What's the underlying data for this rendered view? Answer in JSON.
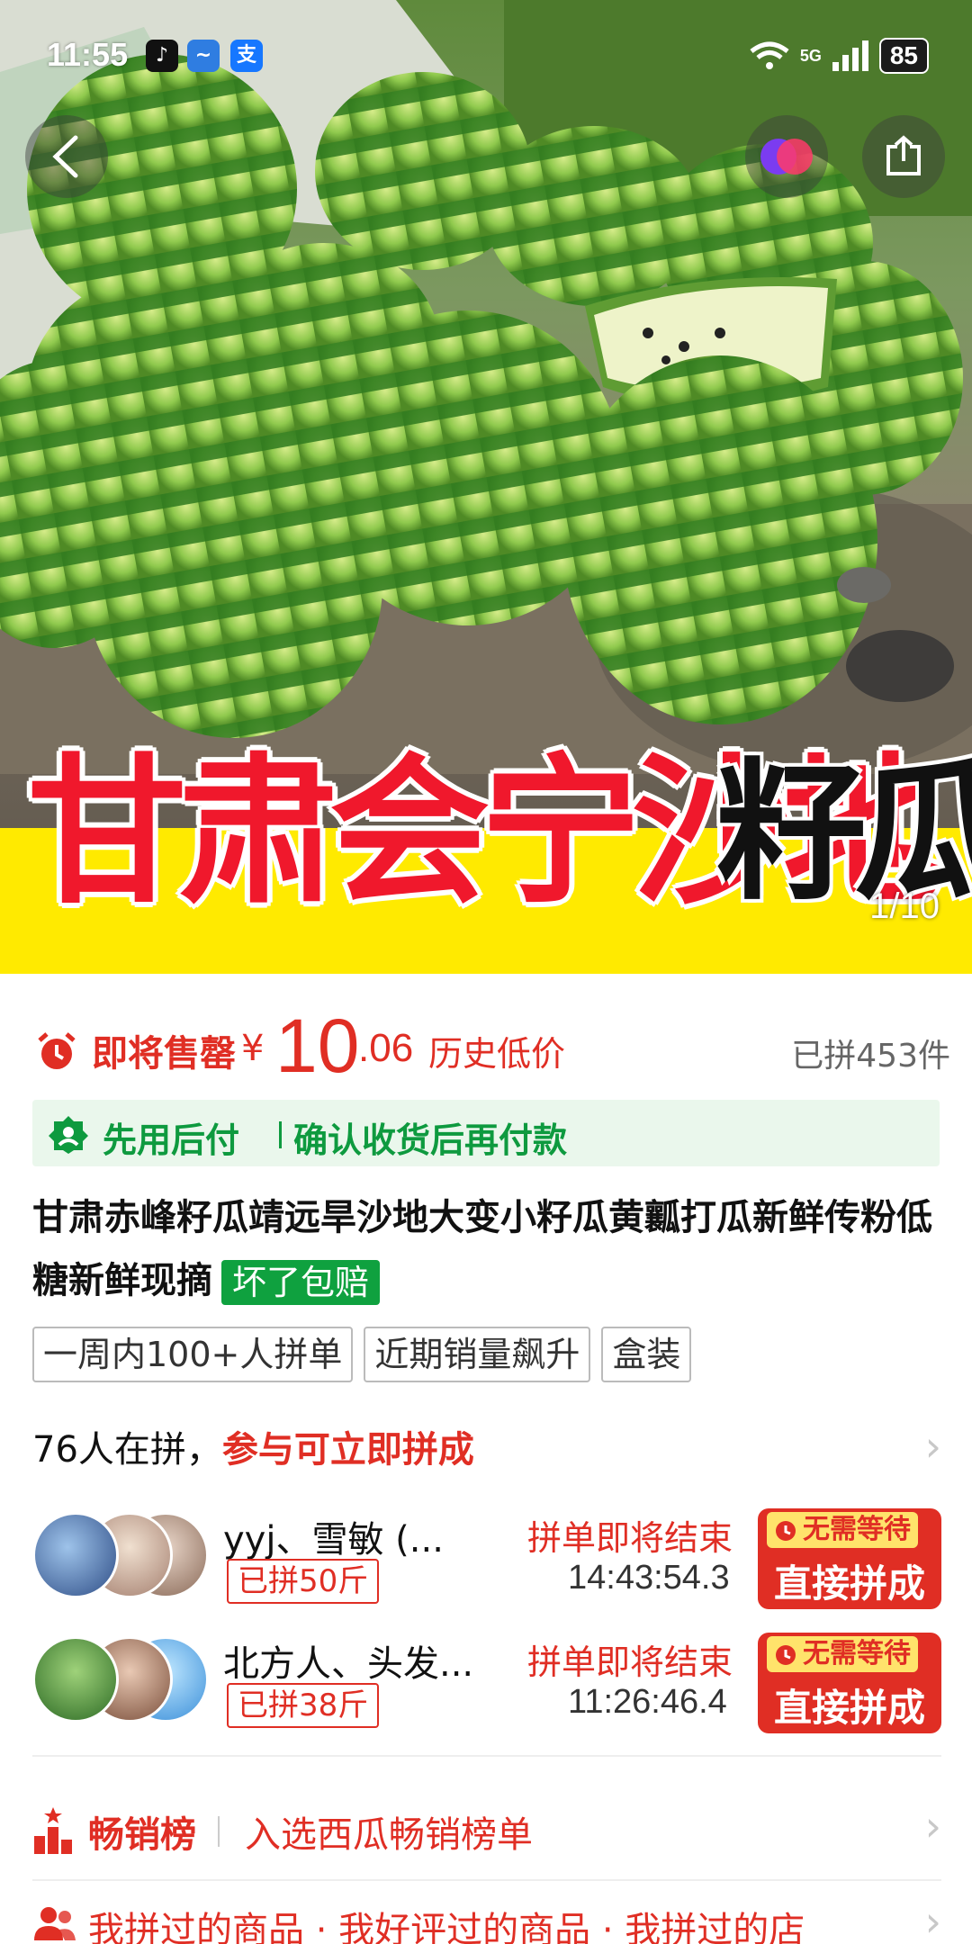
{
  "status_bar": {
    "time": "11:55",
    "network": "5G",
    "battery": "85"
  },
  "hero": {
    "banner_red": "甘肃会宁沙地",
    "banner_black": "籽瓜",
    "page_indicator": "1/10"
  },
  "price": {
    "label": "即将售罄",
    "currency": "¥",
    "integer": "10",
    "decimal": ".06",
    "note": "历史低价",
    "sold": "已拼453件",
    "accent": "#e02e24"
  },
  "payment": {
    "label": "先用后付",
    "detail": "确认收货后再付款",
    "color": "#0e9a3f"
  },
  "product": {
    "title": "甘肃赤峰籽瓜靖远旱沙地大变小籽瓜黄瓤打瓜新鲜传粉低糖新鲜现摘",
    "guarantee": "坏了包赔"
  },
  "tags": [
    "一周内100+人拼单",
    "近期销量飙升",
    "盒装"
  ],
  "group": {
    "count_text": "76人在拼，",
    "cta": "参与可立即拼成"
  },
  "joins": [
    {
      "names": "yyj、雪敏 (...",
      "joined": "已拼50斤",
      "end_label": "拼单即将结束",
      "countdown": "14:43:54.3",
      "no_wait": "无需等待",
      "button": "直接拼成"
    },
    {
      "names": "北方人、头发...",
      "joined": "已拼38斤",
      "end_label": "拼单即将结束",
      "countdown": "11:26:46.4",
      "no_wait": "无需等待",
      "button": "直接拼成"
    }
  ],
  "ranking": {
    "title": "畅销榜",
    "text": "入选西瓜畅销榜单"
  },
  "history": {
    "text": "我拼过的商品 · 我好评过的商品 · 我拼过的店"
  }
}
